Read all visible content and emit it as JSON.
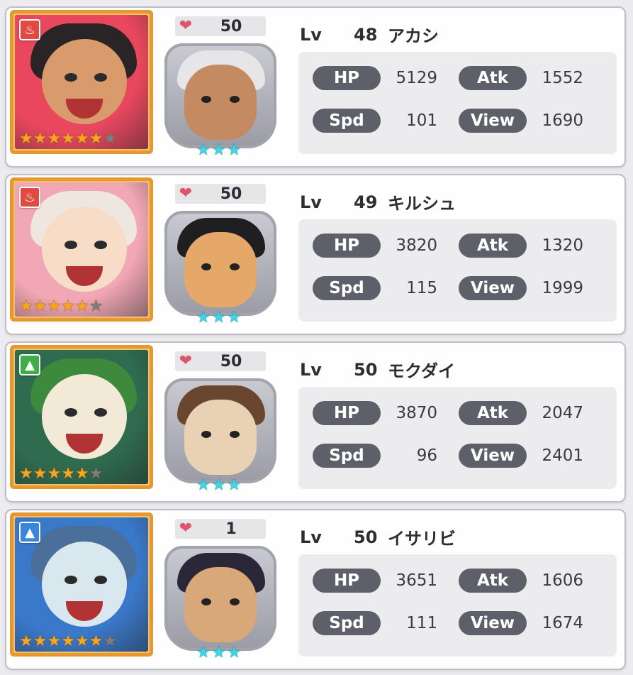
{
  "labels": {
    "lv": "Lv",
    "hp": "HP",
    "atk": "Atk",
    "spd": "Spd",
    "view": "View"
  },
  "characters": [
    {
      "name": "アカシ",
      "level": "48",
      "bond": "50",
      "rarity": 6,
      "rarity_max": 7,
      "sub_rarity": 3,
      "element_icon": "fire-icon",
      "element_color": "#e04a40",
      "hp": "5129",
      "atk": "1552",
      "spd": "101",
      "view": "1690",
      "colors": {
        "bg": "#e8475e",
        "skin": "#d99a6c",
        "hair": "#2a2426",
        "sub_bg": "#c9c9d1",
        "sub_skin": "#c48a62",
        "sub_hair": "#e6e6e8"
      }
    },
    {
      "name": "キルシュ",
      "level": "49",
      "bond": "50",
      "rarity": 5,
      "rarity_max": 6,
      "sub_rarity": 3,
      "element_icon": "fire-icon",
      "element_color": "#e04a40",
      "hp": "3820",
      "atk": "1320",
      "spd": "115",
      "view": "1999",
      "colors": {
        "bg": "#f2a7b4",
        "skin": "#f7dcc8",
        "hair": "#efe6df",
        "sub_bg": "#c9c9d1",
        "sub_skin": "#e6a868",
        "sub_hair": "#1f1f22"
      }
    },
    {
      "name": "モクダイ",
      "level": "50",
      "bond": "50",
      "rarity": 5,
      "rarity_max": 6,
      "sub_rarity": 3,
      "element_icon": "wood-icon",
      "element_color": "#3fae4a",
      "hp": "3870",
      "atk": "2047",
      "spd": "96",
      "view": "2401",
      "colors": {
        "bg": "#2f6b4f",
        "skin": "#f2ead6",
        "hair": "#3d8a3e",
        "sub_bg": "#c9c9d1",
        "sub_skin": "#e9d2b4",
        "sub_hair": "#6a4630"
      }
    },
    {
      "name": "イサリビ",
      "level": "50",
      "bond": "1",
      "rarity": 6,
      "rarity_max": 7,
      "sub_rarity": 3,
      "element_icon": "water-icon",
      "element_color": "#3a86d8",
      "hp": "3651",
      "atk": "1606",
      "spd": "111",
      "view": "1674",
      "colors": {
        "bg": "#3a78c9",
        "skin": "#d9e8ee",
        "hair": "#4a6f9a",
        "sub_bg": "#c9c9d1",
        "sub_skin": "#d9a878",
        "sub_hair": "#2a2838"
      }
    }
  ]
}
